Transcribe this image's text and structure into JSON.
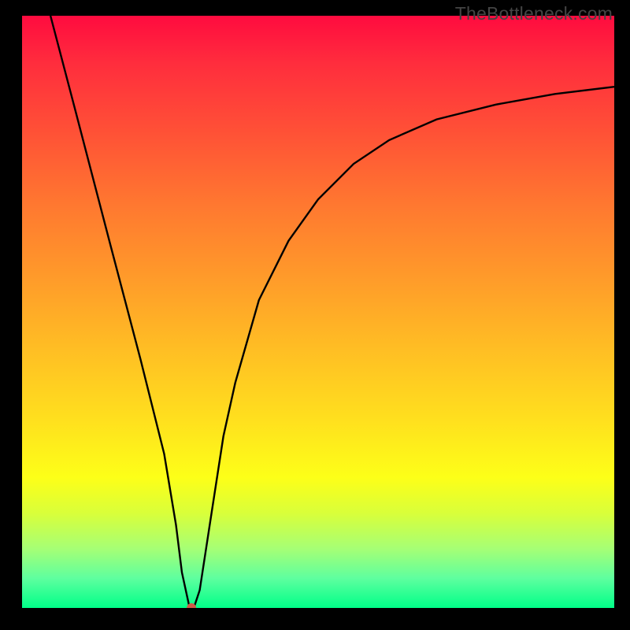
{
  "watermark": "TheBottleneck.com",
  "chart_data": {
    "type": "line",
    "title": "",
    "xlabel": "",
    "ylabel": "",
    "xlim": [
      0,
      100
    ],
    "ylim": [
      0,
      100
    ],
    "grid": false,
    "legend": false,
    "series": [
      {
        "name": "curve",
        "x": [
          4.8,
          9.0,
          15.0,
          20.0,
          24.0,
          26.0,
          27.0,
          28.3,
          29.0,
          30.0,
          32.0,
          34.0,
          36.0,
          40.0,
          45.0,
          50.0,
          56.0,
          62.0,
          70.0,
          80.0,
          90.0,
          100.0
        ],
        "y": [
          100.0,
          84.0,
          61.0,
          42.0,
          26.0,
          14.0,
          6.0,
          0.0,
          0.0,
          3.0,
          16.0,
          29.0,
          38.0,
          52.0,
          62.0,
          69.0,
          75.0,
          79.0,
          82.5,
          85.0,
          86.8,
          88.0
        ]
      }
    ],
    "marker": {
      "x": 28.6,
      "y": 0,
      "color": "#cf5a48"
    },
    "background_gradient": {
      "top": "#ff0b3f",
      "mid": "#ffdf1e",
      "bottom": "#00ff88"
    }
  }
}
